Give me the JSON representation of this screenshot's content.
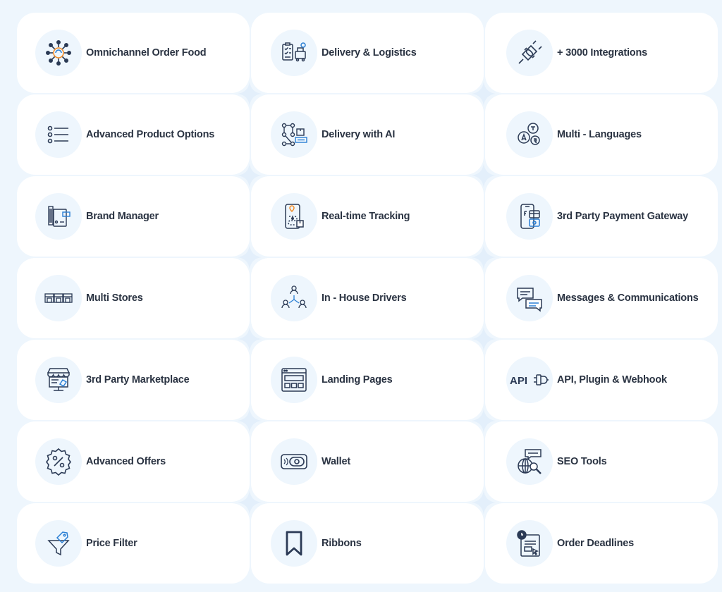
{
  "features": [
    {
      "label": "Omnichannel Order Food",
      "icon": "omnichannel-icon"
    },
    {
      "label": "Delivery & Logistics",
      "icon": "delivery-logistics-icon"
    },
    {
      "label": "+ 3000 Integrations",
      "icon": "plug-integrations-icon"
    },
    {
      "label": "Advanced Product Options",
      "icon": "list-options-icon"
    },
    {
      "label": "Delivery with AI",
      "icon": "ai-delivery-icon"
    },
    {
      "label": "Multi - Languages",
      "icon": "languages-icon"
    },
    {
      "label": "Brand Manager",
      "icon": "brand-manager-icon"
    },
    {
      "label": "Real-time Tracking",
      "icon": "tracking-icon"
    },
    {
      "label": "3rd Party Payment Gateway",
      "icon": "payment-gateway-icon"
    },
    {
      "label": "Multi Stores",
      "icon": "multi-stores-icon"
    },
    {
      "label": "In - House Drivers",
      "icon": "drivers-icon"
    },
    {
      "label": "Messages & Communications",
      "icon": "messages-icon"
    },
    {
      "label": "3rd Party Marketplace",
      "icon": "marketplace-icon"
    },
    {
      "label": "Landing Pages",
      "icon": "landing-pages-icon"
    },
    {
      "label": "API, Plugin & Webhook",
      "icon": "api-plugin-icon",
      "icon_text": "API"
    },
    {
      "label": "Advanced Offers",
      "icon": "offers-percent-icon"
    },
    {
      "label": "Wallet",
      "icon": "wallet-icon"
    },
    {
      "label": "SEO Tools",
      "icon": "seo-tools-icon"
    },
    {
      "label": "Price Filter",
      "icon": "price-filter-icon"
    },
    {
      "label": "Ribbons",
      "icon": "ribbon-bookmark-icon"
    },
    {
      "label": "Order Deadlines",
      "icon": "order-deadlines-icon"
    }
  ],
  "colors": {
    "page_background": "#eef6fd",
    "card_background": "#ffffff",
    "icon_stroke": "#2b3a55",
    "accent_orange": "#f28c28",
    "accent_blue": "#2a7fd4",
    "text": "#2a3342"
  }
}
